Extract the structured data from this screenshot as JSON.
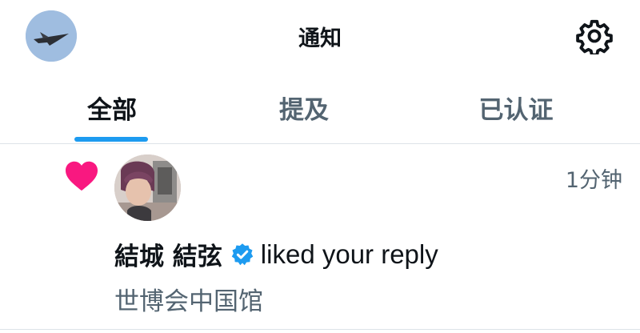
{
  "header": {
    "title": "通知"
  },
  "tabs": [
    {
      "label": "全部",
      "active": true
    },
    {
      "label": "提及",
      "active": false
    },
    {
      "label": "已认证",
      "active": false
    }
  ],
  "notification": {
    "user_name": "結城 結弦",
    "action": "liked your reply",
    "time": "1分钟",
    "post_text": "世博会中国馆"
  },
  "icons": {
    "settings": "gear-icon",
    "like": "heart-icon",
    "verified": "verified-badge-icon"
  },
  "colors": {
    "accent": "#1d9bf0",
    "heart": "#f91880",
    "secondary_text": "#536471",
    "divider": "#dde3e8"
  }
}
